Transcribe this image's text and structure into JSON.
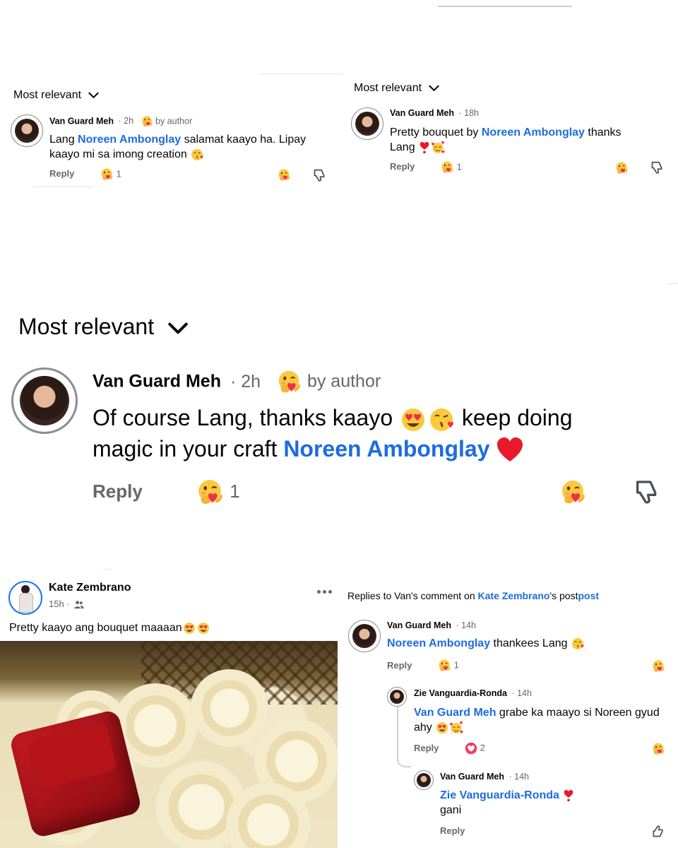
{
  "panel1": {
    "sort_label": "Most relevant",
    "author": "Van Guard Meh",
    "time": "· 2h",
    "badge": "by author",
    "text_pre": "Lang ",
    "mention": "Noreen Ambonglay",
    "text_post": " salamat kaayo ha. Lipay",
    "text_line2": "kaayo mi sa imong creation",
    "reply_label": "Reply",
    "reaction_count": "1"
  },
  "panel2": {
    "sort_label": "Most relevant",
    "author": "Van Guard Meh",
    "time": "· 18h",
    "text_pre": "Pretty bouquet by ",
    "mention": "Noreen Ambonglay",
    "text_post": " thanks",
    "text_line2": "Lang",
    "reply_label": "Reply",
    "reaction_count": "1"
  },
  "panel3": {
    "sort_label": "Most relevant",
    "author": "Van Guard Meh",
    "time": "· 2h",
    "badge": "by author",
    "text_line1_pre": "Of course Lang, thanks kaayo",
    "text_line1_post": " keep doing",
    "text_line2_pre": "magic in your craft ",
    "mention": "Noreen Ambonglay",
    "reply_label": "Reply",
    "reaction_count": "1"
  },
  "panel4": {
    "author": "Kate Zembrano",
    "time": "15h ·",
    "text": "Pretty kaayo ang bouquet maaaan"
  },
  "panel5": {
    "header_pre": "Replies to Van's comment on ",
    "header_name": "Kate Zembrano",
    "header_post": "'s post",
    "comment1": {
      "author": "Van Guard Meh",
      "time": "· 14h",
      "mention": "Noreen Ambonglay",
      "text": " thankees Lang",
      "reply_label": "Reply",
      "reaction_count": "1"
    },
    "comment2": {
      "author": "Zie Vanguardia-Ronda",
      "time": "· 14h",
      "mention": "Van Guard Meh",
      "text": " grabe ka maayo si Noreen gyud",
      "text_line2": "ahy",
      "reply_label": "Reply",
      "reaction_count": "2"
    },
    "comment3": {
      "author": "Van Guard Meh",
      "time": "· 14h",
      "mention": "Zie Vanguardia-Ronda",
      "text_line2": "gani",
      "reply_label": "Reply"
    }
  },
  "icons": {
    "hug_emoji": "hug-emoji-icon",
    "kiss_emoji": "face-blowing-kiss-icon",
    "heart_eyes": "heart-eyes-icon",
    "smiling_hearts": "smiling-face-with-hearts-icon",
    "red_heart": "red-heart-icon",
    "heart_exclamation": "heart-exclamation-icon",
    "dislike": "thumbs-down-icon",
    "like": "thumbs-up-icon",
    "more": "more-dots-icon",
    "friends": "friends-audience-icon"
  },
  "colors": {
    "link": "#1d6ce0",
    "muted": "#65676b",
    "love": "#f33e58"
  }
}
